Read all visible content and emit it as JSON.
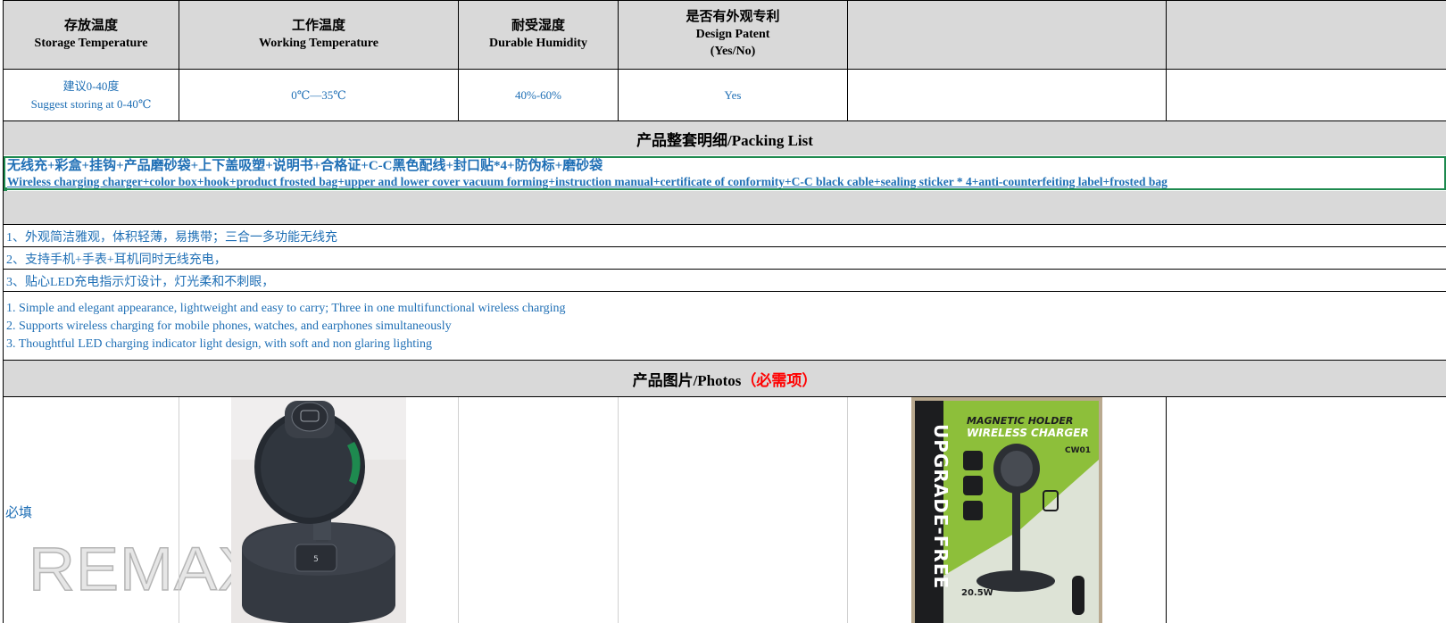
{
  "headers": [
    {
      "zh": "存放温度",
      "en": "Storage Temperature"
    },
    {
      "zh": "工作温度",
      "en": "Working Temperature"
    },
    {
      "zh": "耐受湿度",
      "en": "Durable Humidity"
    },
    {
      "zh": "是否有外观专利",
      "en": "Design Patent",
      "en2": "(Yes/No)"
    }
  ],
  "values": {
    "storage_zh": "建议0-40度",
    "storage_en": "Suggest storing at 0-40℃",
    "working": "0℃—35℃",
    "humidity": "40%-60%",
    "patent": "Yes"
  },
  "packing": {
    "title": "产品整套明细/Packing List",
    "zh": "无线充+彩盒+挂钩+产品磨砂袋+上下盖吸塑+说明书+合格证+C-C黑色配线+封口贴*4+防伪标+磨砂袋",
    "en": "Wireless charging charger+color box+hook+product frosted bag+upper and lower cover vacuum forming+instruction manual+certificate of conformity+C-C black cable+sealing sticker * 4+anti-counterfeiting label+frosted bag"
  },
  "features_zh": [
    "1、外观简洁雅观，体积轻薄，易携带；三合一多功能无线充",
    "2、支持手机+手表+耳机同时无线充电，",
    "3、贴心LED充电指示灯设计，灯光柔和不刺眼，"
  ],
  "features_en": [
    "1. Simple and elegant appearance, lightweight and easy to carry; Three in one multifunctional wireless charging",
    "2. Supports wireless charging for mobile phones, watches, and earphones simultaneously",
    "3. Thoughtful LED charging indicator light design, with soft and non glaring lighting"
  ],
  "photos": {
    "title": "产品图片/Photos",
    "title_required": "（必需项）",
    "required_label": "必填",
    "watermark": "REMAX",
    "box_text": {
      "line1": "MAGNETIC HOLDER",
      "line2": "WIRELESS CHARGER",
      "model": "CW01",
      "side": "UPGRADE-FREE",
      "power": "20.5W"
    }
  },
  "colors": {
    "header_gray": "#d9d9d9",
    "text_blue": "#1f6fb5",
    "required_red": "#ff0000",
    "selection_green": "#1e8a4f"
  }
}
